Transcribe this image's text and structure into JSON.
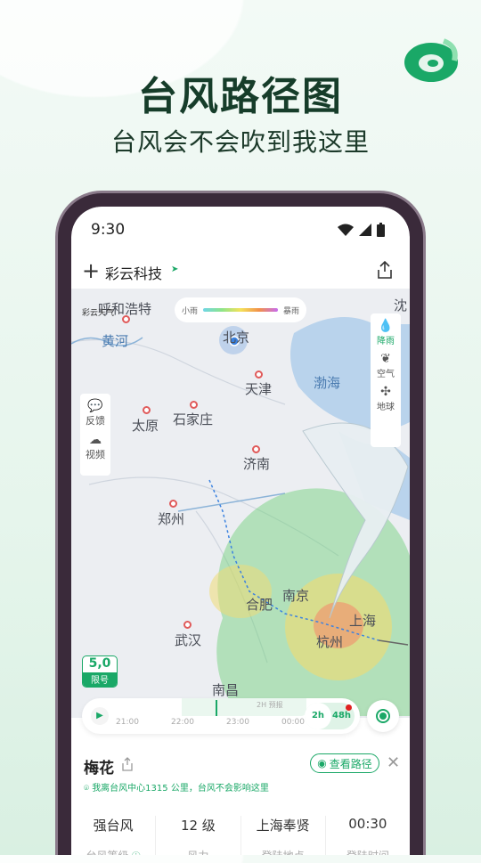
{
  "promo": {
    "title": "台风路径图",
    "subtitle": "台风会不会吹到我这里"
  },
  "status_bar": {
    "time": "9:30"
  },
  "header": {
    "location": "彩云科技",
    "add_icon": "plus-icon",
    "share_icon": "share-icon"
  },
  "map": {
    "brand": "彩云天气",
    "legend": {
      "min": "小雨",
      "max": "暴雨"
    },
    "cities": [
      "呼和浩特",
      "北京",
      "天津",
      "太原",
      "石家庄",
      "济南",
      "郑州",
      "合肥",
      "南京",
      "上海",
      "杭州",
      "武汉",
      "南昌",
      "沈"
    ],
    "features": [
      "黄河",
      "渤海"
    ],
    "layers": [
      {
        "label": "降雨",
        "icon": "rain-icon",
        "active": true
      },
      {
        "label": "空气",
        "icon": "leaf-icon"
      },
      {
        "label": "地球",
        "icon": "fan-icon"
      }
    ],
    "tools": [
      {
        "label": "反馈",
        "icon": "feedback-icon"
      },
      {
        "label": "视频",
        "icon": "download-icon"
      }
    ],
    "restriction": {
      "value": "5,0",
      "label": "限号"
    }
  },
  "timeline": {
    "ticks": [
      "21:00",
      "22:00",
      "23:00",
      "00:00"
    ],
    "forecast_label": "2H 预报",
    "modes": [
      "2h",
      "48h"
    ],
    "active_mode": "2h"
  },
  "typhoon": {
    "name": "梅花",
    "view_path": "查看路径",
    "distance_note": "我离台风中心1315 公里，台风不会影响这里",
    "stats": [
      {
        "value": "强台风",
        "label": "台风等级"
      },
      {
        "value": "12 级",
        "label": "风力"
      },
      {
        "value": "上海奉贤",
        "label": "登陆地点"
      },
      {
        "value": "00:30",
        "label": "登陆时间"
      }
    ]
  },
  "colors": {
    "accent": "#1aa867",
    "title": "#163d2a",
    "sea": "#b9d3ec"
  }
}
